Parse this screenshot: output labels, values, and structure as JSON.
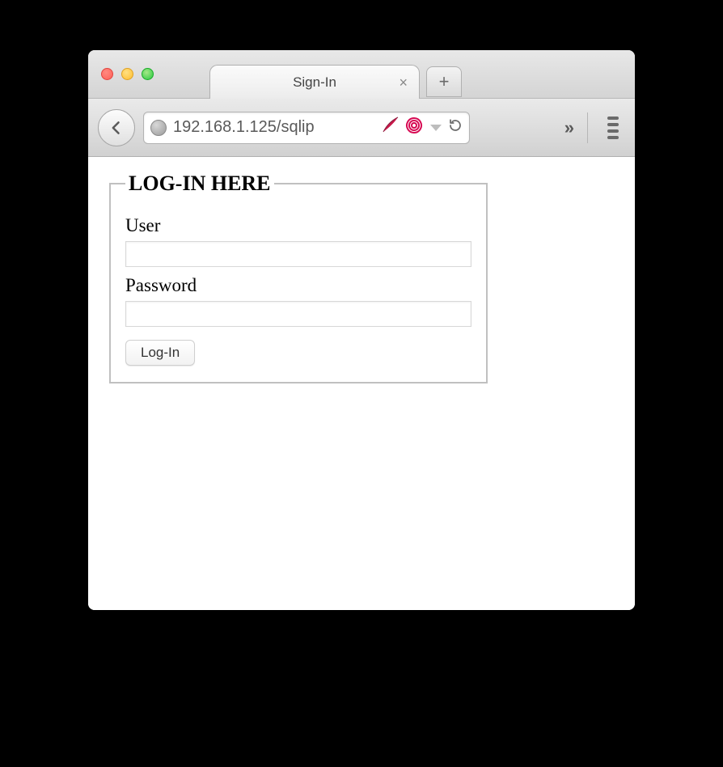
{
  "window": {
    "tab_title": "Sign-In",
    "url": "192.168.1.125/sqlip"
  },
  "form": {
    "legend": "LOG-IN HERE",
    "user_label": "User",
    "user_value": "",
    "password_label": "Password",
    "password_value": "",
    "submit_label": "Log-In"
  }
}
